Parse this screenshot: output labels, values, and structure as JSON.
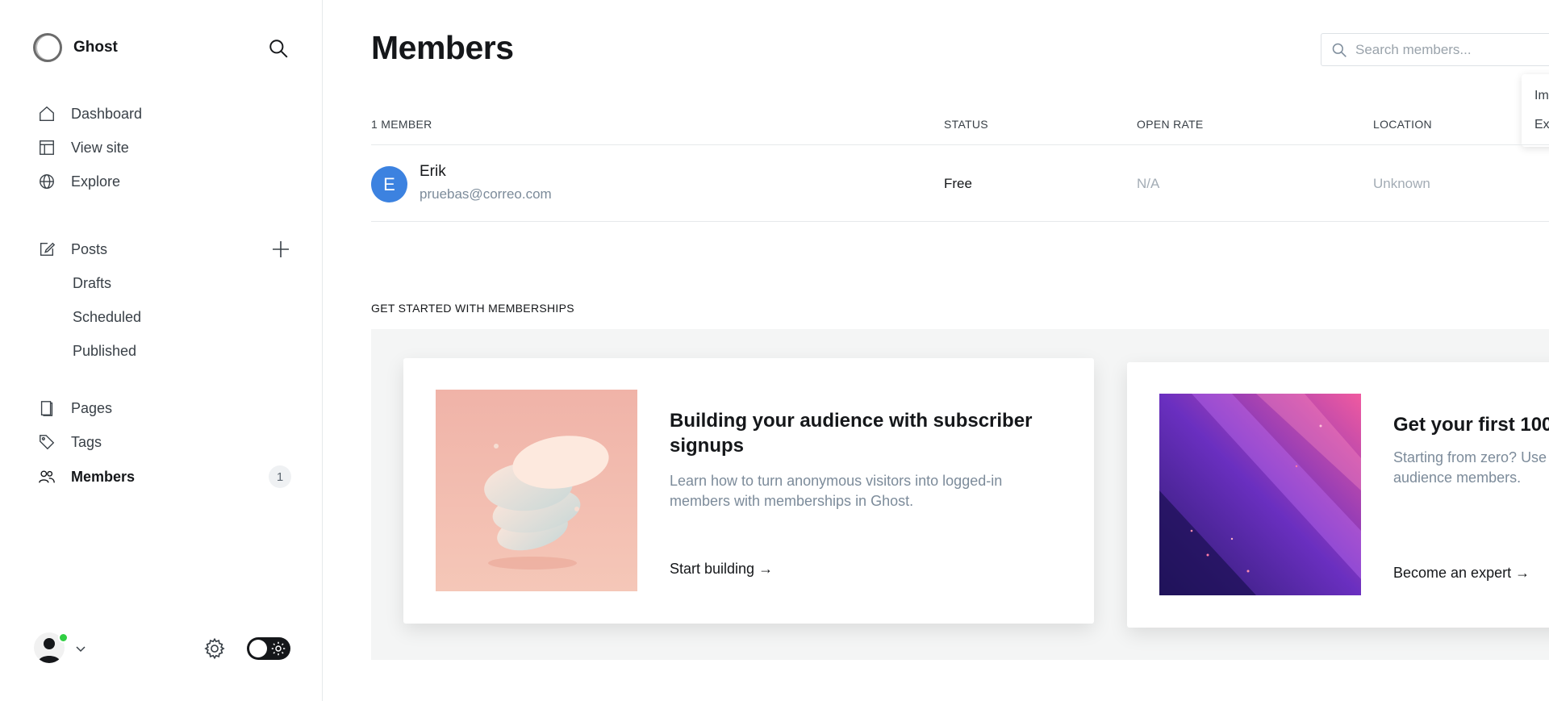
{
  "sidebar": {
    "brand": "Ghost",
    "nav": [
      {
        "label": "Dashboard"
      },
      {
        "label": "View site"
      },
      {
        "label": "Explore"
      }
    ],
    "posts": {
      "label": "Posts",
      "sub": [
        "Drafts",
        "Scheduled",
        "Published"
      ]
    },
    "nav2": [
      {
        "label": "Pages"
      },
      {
        "label": "Tags"
      },
      {
        "label": "Members",
        "count": "1"
      }
    ]
  },
  "main": {
    "title": "Members",
    "search_placeholder": "Search members...",
    "dropdown": [
      "Im",
      "Ex"
    ],
    "table": {
      "headers": [
        "1 MEMBER",
        "STATUS",
        "OPEN RATE",
        "LOCATION"
      ],
      "rows": [
        {
          "initial": "E",
          "name": "Erik",
          "email": "pruebas@correo.com",
          "status": "Free",
          "open_rate": "N/A",
          "location": "Unknown"
        }
      ]
    },
    "get_started": {
      "title": "GET STARTED WITH MEMBERSHIPS",
      "cards": [
        {
          "heading": "Building your audience with subscriber signups",
          "text": "Learn how to turn anonymous visitors into logged-in members with memberships in Ghost.",
          "link": "Start building →"
        },
        {
          "heading": "Get your first 100",
          "text": "Starting from zero? Use audience members.",
          "link": "Become an expert →"
        }
      ]
    }
  },
  "colors": {
    "accent": "#30cf43",
    "avatar": "#3c82e0",
    "text": "#15171a",
    "muted": "#7c8b9a"
  }
}
